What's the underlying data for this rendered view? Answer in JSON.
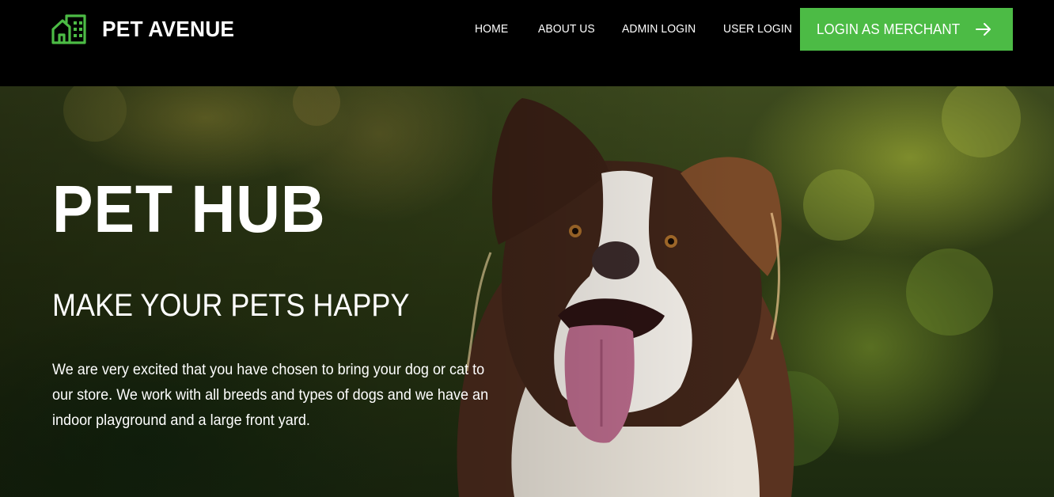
{
  "brand": {
    "name": "PET AVENUE",
    "logo_icon": "green-house-icon",
    "accent_color": "#4cbb45"
  },
  "nav": {
    "items": [
      {
        "label": "HOME"
      },
      {
        "label": "ABOUT US"
      },
      {
        "label": "ADMIN LOGIN"
      },
      {
        "label": "USER LOGIN"
      }
    ],
    "merchant_button": {
      "label": "LOGIN AS MERCHANT",
      "icon": "arrow-right-icon"
    }
  },
  "hero": {
    "title": "PET HUB",
    "subtitle": "MAKE YOUR PETS HAPPY",
    "description": "We are very excited that you have chosen to bring your dog or cat to our store. We work with all breeds and types of dogs and we have an indoor playground and a large front yard."
  }
}
